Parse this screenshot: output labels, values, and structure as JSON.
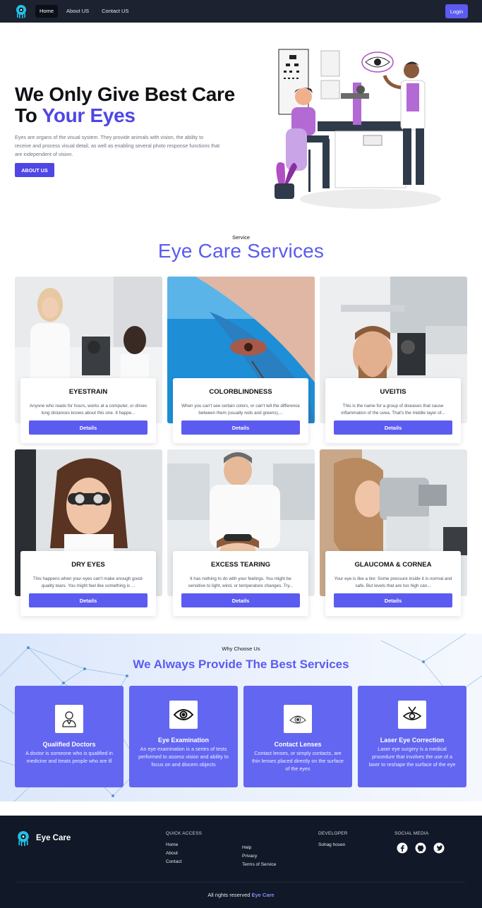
{
  "nav": {
    "links": [
      "Home",
      "About US",
      "Contact US"
    ],
    "login": "Login"
  },
  "hero": {
    "title_line1": "We Only Give Best Care",
    "title_to": "To ",
    "title_accent": "Your Eyes",
    "description": "Eyes are organs of the visual system. They provide animals with vision, the ability to receive and process visual detail, as well as enabling several photo response functions that are independent of vision.",
    "button": "ABOUT US"
  },
  "services": {
    "eyebrow": "Service",
    "title": "Eye Care Services",
    "cards": [
      {
        "title": "EYESTRAIN",
        "desc": "Anyone who reads for hours, works at a computer, or drives long distances knows about this one. It happe...",
        "button": "Details"
      },
      {
        "title": "COLORBLINDNESS",
        "desc": "When you can't see certain colors, or can't tell the difference between them (usually reds and greens),...",
        "button": "Details"
      },
      {
        "title": "UVEITIS",
        "desc": "This is the name for a group of diseases that cause inflammation of the uvea. That's the middle layer of...",
        "button": "Details"
      },
      {
        "title": "DRY EYES",
        "desc": "This happens when your eyes can't make enough good-quality tears. You might feel like something is ...",
        "button": "Details"
      },
      {
        "title": "EXCESS TEARING",
        "desc": "It has nothing to do with your feelings. You might be sensitive to light, wind, or temperature changes. Try...",
        "button": "Details"
      },
      {
        "title": "GLAUCOMA & CORNEA",
        "desc": "Your eye is like a tire: Some pressure inside it is normal and safe. But levels that are too high can...",
        "button": "Details"
      }
    ]
  },
  "why": {
    "eyebrow": "Why Choose Us",
    "title": "We Always Provide The Best Services",
    "features": [
      {
        "icon": "doctor-icon",
        "title": "Qualified Doctors",
        "desc": "A doctor is someone who is qualified in medicine and treats people who are ill"
      },
      {
        "icon": "eye-icon",
        "title": "Eye Examination",
        "desc": "An eye examination is a series of tests performed to assess vision and ability to focus on and discern objects"
      },
      {
        "icon": "contact-lens-icon",
        "title": "Contact Lenses",
        "desc": "Contact lenses, or simply contacts, are thin lenses placed directly on the surface of the eyes"
      },
      {
        "icon": "laser-eye-icon",
        "title": "Laser Eye Correction",
        "desc": "Laser eye surgery is a medical procedure that involves the use of a laser to reshape the surface of the eye"
      }
    ]
  },
  "footer": {
    "brand": "Eye Care",
    "quick_access_heading": "QUICK ACCESS",
    "quick_links": [
      "Home",
      "About",
      "Contact"
    ],
    "more_links": [
      "Help",
      "Privacy",
      "Terms of Service"
    ],
    "developer_heading": "DEVELOPER",
    "developer_name": "Sohag hosen",
    "social_heading": "SOCIAL MEDIA",
    "social_icons": [
      "facebook-icon",
      "github-icon",
      "twitter-icon"
    ],
    "copyright_prefix": "All rights reserved ",
    "copyright_brand": "Eye Care"
  },
  "colors": {
    "accent": "#5b5bf0",
    "nav_bg": "#1c2230",
    "footer_bg": "#111827",
    "feature_bg": "#6366f1"
  }
}
